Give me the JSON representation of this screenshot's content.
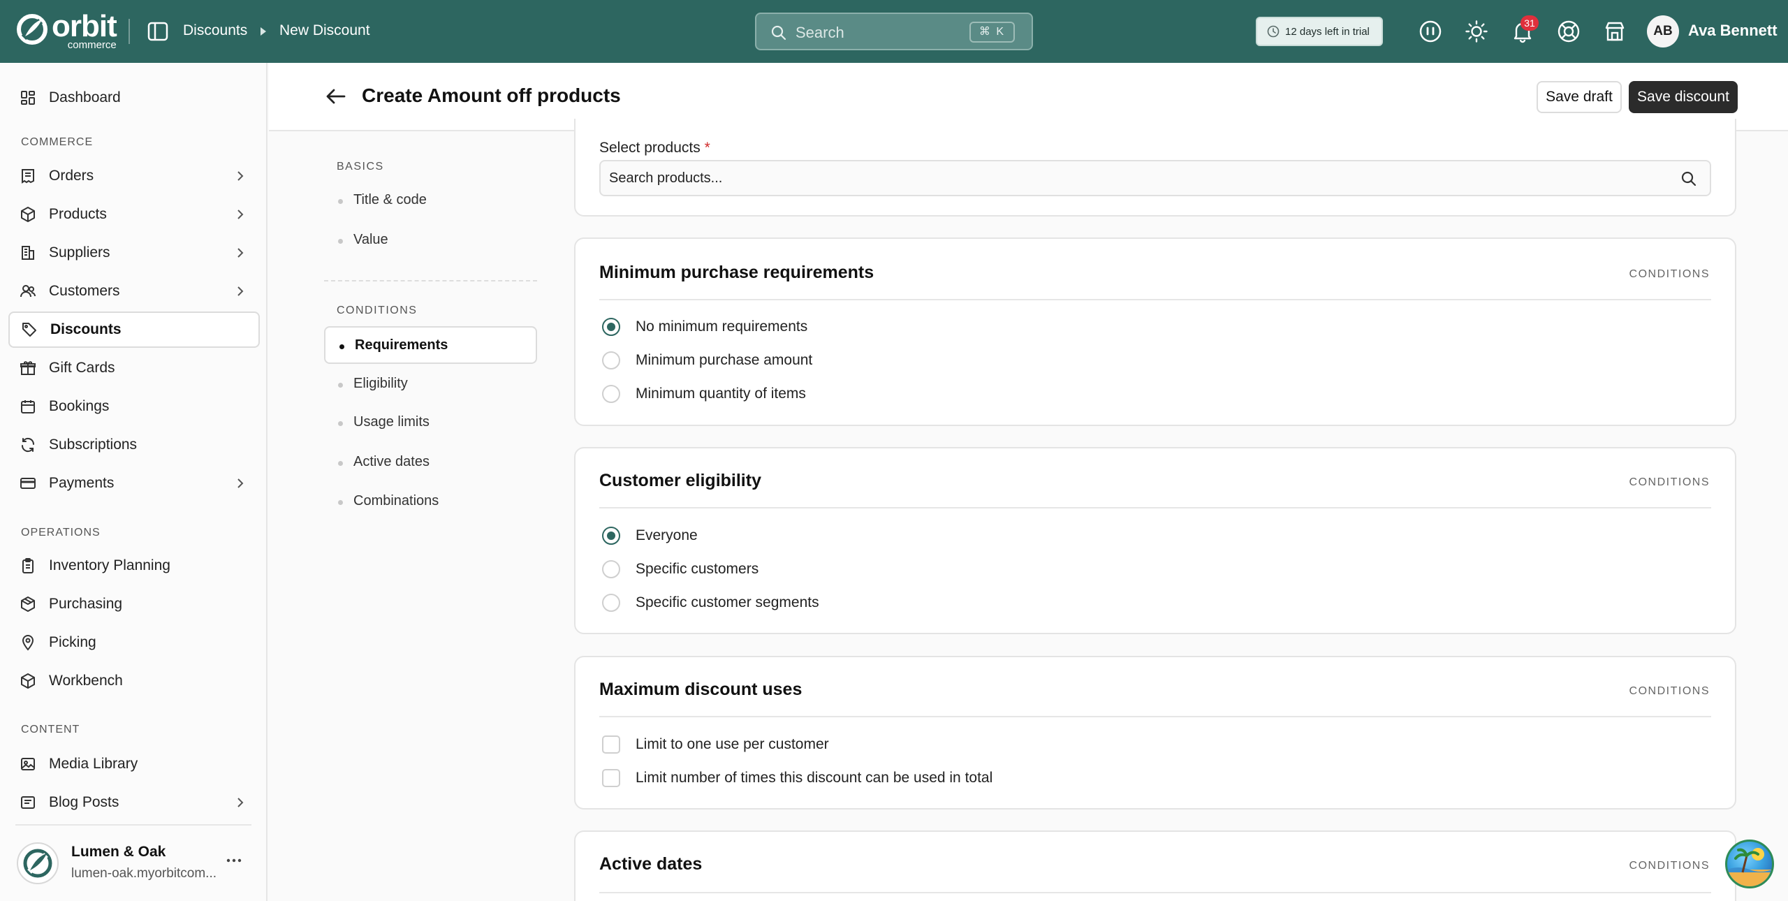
{
  "topbar": {
    "logo_word": "orbit",
    "logo_sub": "commerce",
    "breadcrumb": [
      "Discounts",
      "New Discount"
    ],
    "search_placeholder": "Search",
    "search_shortcut": "⌘ K",
    "trial_text": "12 days left in trial",
    "notification_count": "31",
    "user_initials": "AB",
    "user_name": "Ava Bennett"
  },
  "sidebar": {
    "items": {
      "dashboard": "Dashboard",
      "orders": "Orders",
      "products": "Products",
      "suppliers": "Suppliers",
      "customers": "Customers",
      "discounts": "Discounts",
      "gift_cards": "Gift Cards",
      "bookings": "Bookings",
      "subscriptions": "Subscriptions",
      "payments": "Payments",
      "inventory_planning": "Inventory Planning",
      "purchasing": "Purchasing",
      "picking": "Picking",
      "workbench": "Workbench",
      "media_library": "Media Library",
      "blog_posts": "Blog Posts"
    },
    "sections": {
      "commerce": "COMMERCE",
      "operations": "OPERATIONS",
      "content": "CONTENT"
    },
    "store": {
      "name": "Lumen & Oak",
      "url": "lumen-oak.myorbitcom..."
    }
  },
  "header": {
    "title": "Create Amount off products",
    "save_draft": "Save draft",
    "save_discount": "Save discount"
  },
  "section_nav": {
    "basics_title": "BASICS",
    "basics": [
      "Title & code",
      "Value"
    ],
    "conditions_title": "CONDITIONS",
    "conditions": [
      "Requirements",
      "Eligibility",
      "Usage limits",
      "Active dates",
      "Combinations"
    ]
  },
  "products_card": {
    "label": "Select products",
    "required_mark": "*",
    "placeholder": "Search products..."
  },
  "requirements_card": {
    "title": "Minimum purchase requirements",
    "tag": "CONDITIONS",
    "options": [
      "No minimum requirements",
      "Minimum purchase amount",
      "Minimum quantity of items"
    ]
  },
  "eligibility_card": {
    "title": "Customer eligibility",
    "tag": "CONDITIONS",
    "options": [
      "Everyone",
      "Specific customers",
      "Specific customer segments"
    ]
  },
  "usage_card": {
    "title": "Maximum discount uses",
    "tag": "CONDITIONS",
    "options": [
      "Limit to one use per customer",
      "Limit number of times this discount can be used in total"
    ]
  },
  "dates_card": {
    "title": "Active dates",
    "tag": "CONDITIONS"
  },
  "colors": {
    "brand": "#2d6660",
    "badge": "#e0303c",
    "primary_button": "#2b2b2b"
  }
}
